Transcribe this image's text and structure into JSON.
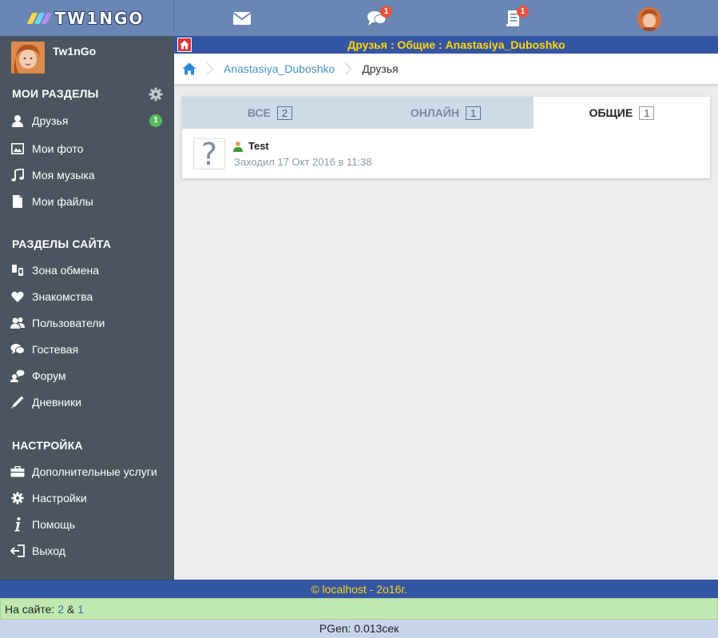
{
  "header": {
    "logo_text": "TW1NGO",
    "messages_icon": "envelope-icon",
    "chat_badge": "1",
    "journal_badge": "1"
  },
  "sidebar": {
    "username": "Tw1nGo",
    "sections": {
      "my": "МОИ РАЗДЕЛЫ",
      "site": "РАЗДЕЛЫ САЙТА",
      "settings": "НАСТРОЙКА"
    },
    "my_items": [
      {
        "label": "Друзья",
        "icon": "user-icon",
        "badge": "1"
      },
      {
        "label": "Мои фото",
        "icon": "image-icon"
      },
      {
        "label": "Моя музыка",
        "icon": "music-icon"
      },
      {
        "label": "Мои файлы",
        "icon": "file-icon"
      }
    ],
    "site_items": [
      {
        "label": "Зона обмена",
        "icon": "exchange-icon"
      },
      {
        "label": "Знакомства",
        "icon": "heart-icon"
      },
      {
        "label": "Пользователи",
        "icon": "users-icon"
      },
      {
        "label": "Гостевая",
        "icon": "comments-icon"
      },
      {
        "label": "Форум",
        "icon": "forum-icon"
      },
      {
        "label": "Дневники",
        "icon": "pen-icon"
      }
    ],
    "settings_items": [
      {
        "label": "Дополнительные услуги",
        "icon": "briefcase-icon"
      },
      {
        "label": "Настройки",
        "icon": "gear-icon"
      },
      {
        "label": "Помощь",
        "icon": "info-icon"
      },
      {
        "label": "Выход",
        "icon": "logout-icon"
      }
    ]
  },
  "page": {
    "title": "Друзья : Общие : Anastasiya_Duboshko",
    "breadcrumb": {
      "user": "Anastasiya_Duboshko",
      "current": "Друзья"
    },
    "tabs": [
      {
        "label": "ВСЕ",
        "count": "2"
      },
      {
        "label": "ОНЛАЙН",
        "count": "1"
      },
      {
        "label": "ОБЩИЕ",
        "count": "1"
      }
    ],
    "friends": [
      {
        "name": "Test",
        "status": "Заходил 17 Окт 2016 в 11:38",
        "photo_placeholder": "?"
      }
    ]
  },
  "footer": {
    "copyright": "© localhost - 2o16г.",
    "online_label": "На сайте:",
    "online_count": "2",
    "online_amp": "&",
    "online_friends": "1",
    "pgen": "PGen: 0.013сек"
  },
  "colors": {
    "header": "#6a86b5",
    "sidebar": "#4a555f",
    "titlebar": "#3455a4",
    "accent_yellow": "#ffd700"
  }
}
